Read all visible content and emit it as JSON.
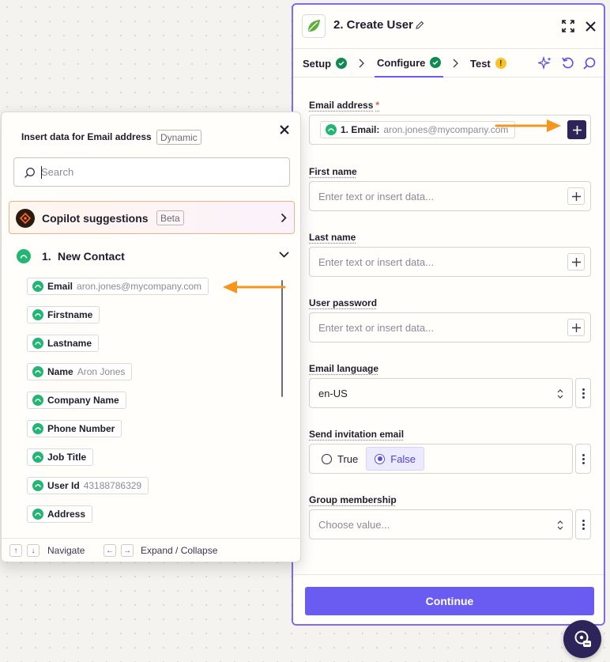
{
  "panel": {
    "title": "2. Create User",
    "tabs": [
      {
        "label": "Setup",
        "status": "complete"
      },
      {
        "label": "Configure",
        "status": "complete"
      },
      {
        "label": "Test",
        "status": "warning",
        "warning_mark": "!"
      }
    ],
    "fields": {
      "email": {
        "label": "Email address",
        "required_mark": "*",
        "pill_label": "1. Email:",
        "pill_value": "aron.jones@mycompany.com"
      },
      "first_name": {
        "label": "First name",
        "placeholder": "Enter text or insert data..."
      },
      "last_name": {
        "label": "Last name",
        "placeholder": "Enter text or insert data..."
      },
      "user_password": {
        "label": "User password",
        "placeholder": "Enter text or insert data..."
      },
      "email_language": {
        "label": "Email language",
        "value": "en-US"
      },
      "send_invitation": {
        "label": "Send invitation email",
        "options": [
          "True",
          "False"
        ],
        "selected": "False"
      },
      "group_membership": {
        "label": "Group membership",
        "placeholder": "Choose value..."
      }
    },
    "continue_label": "Continue"
  },
  "popup": {
    "title": "Insert data for Email address",
    "badge": "Dynamic",
    "search_placeholder": "Search",
    "copilot": {
      "label": "Copilot suggestions",
      "badge": "Beta"
    },
    "step": {
      "number": "1.",
      "name": "New Contact"
    },
    "items": [
      {
        "label": "Email",
        "value": "aron.jones@mycompany.com"
      },
      {
        "label": "Firstname",
        "value": ""
      },
      {
        "label": "Lastname",
        "value": ""
      },
      {
        "label": "Name",
        "value": "Aron Jones"
      },
      {
        "label": "Company Name",
        "value": ""
      },
      {
        "label": "Phone Number",
        "value": ""
      },
      {
        "label": "Job Title",
        "value": ""
      },
      {
        "label": "User Id",
        "value": "43188786329"
      },
      {
        "label": "Address",
        "value": ""
      }
    ],
    "footer": {
      "navigate": "Navigate",
      "expand": "Expand / Collapse",
      "keys": [
        "↑",
        "↓",
        "←",
        "→"
      ]
    }
  },
  "colors": {
    "accent": "#6a5cf0",
    "annotation_arrow": "#f5951d",
    "app_green": "#22b573",
    "dark_button": "#2d2459"
  }
}
